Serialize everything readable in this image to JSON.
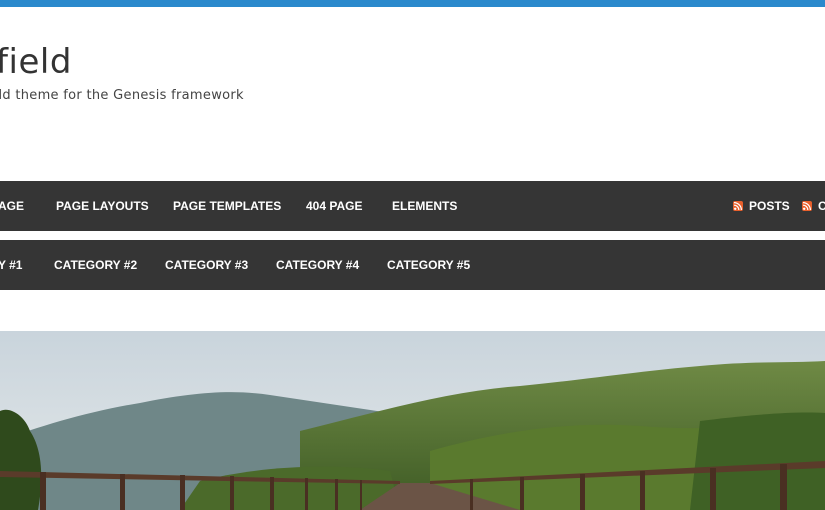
{
  "header": {
    "title": "nfield",
    "description": "hild theme for the Genesis framework"
  },
  "primary_nav": {
    "items": [
      "AGE",
      "PAGE LAYOUTS",
      "PAGE TEMPLATES",
      "404 PAGE",
      "ELEMENTS"
    ],
    "feeds": [
      "POSTS",
      "C"
    ]
  },
  "secondary_nav": {
    "items": [
      "Y #1",
      "CATEGORY #2",
      "CATEGORY #3",
      "CATEGORY #4",
      "CATEGORY #5"
    ]
  },
  "colors": {
    "accent": "#2a89cc",
    "nav_bg": "#353535",
    "rss": "#e8602c"
  },
  "hero": {
    "image": "mountain-bridge-photo"
  }
}
